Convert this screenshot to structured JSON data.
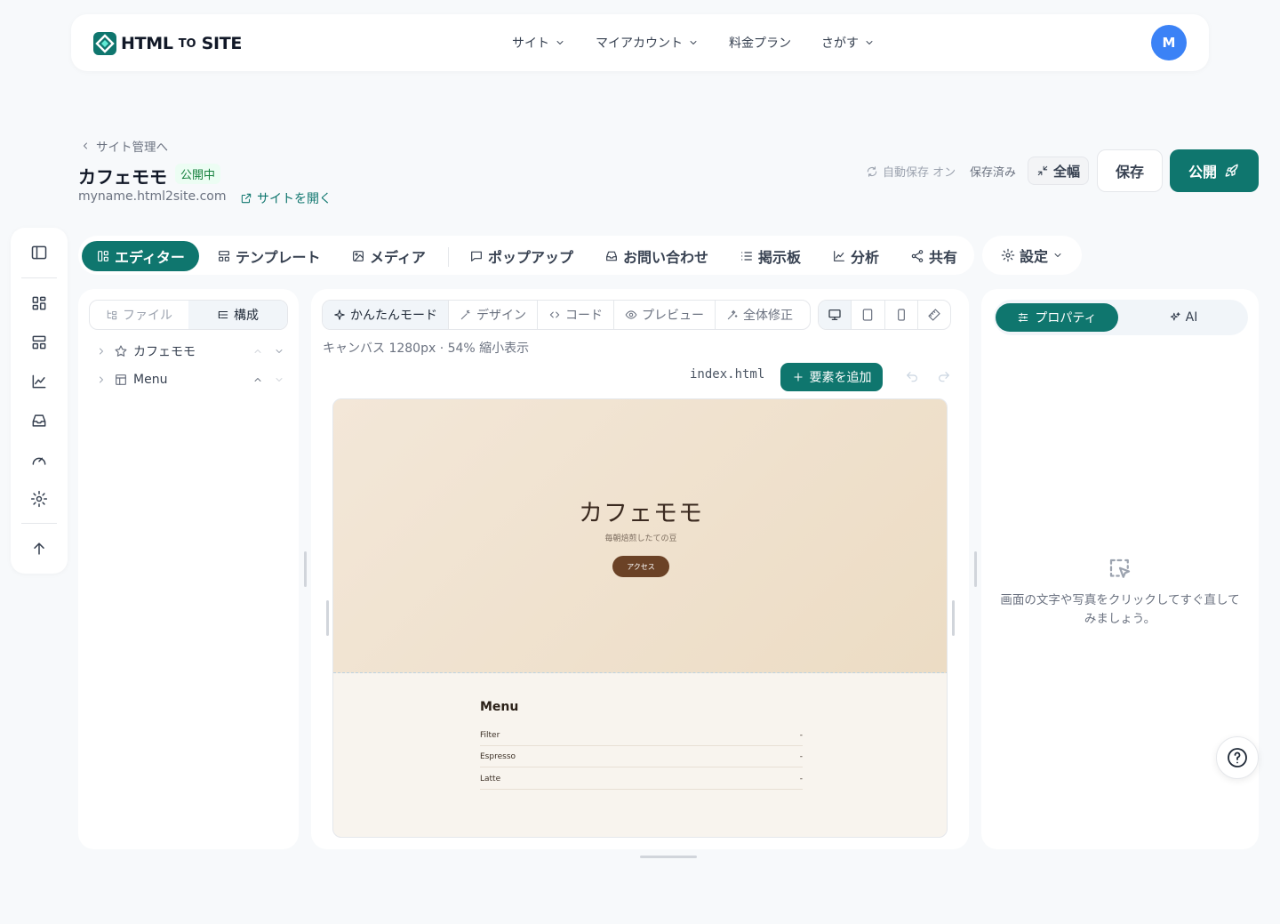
{
  "brand": {
    "part1": "HTML",
    "part2": "TO",
    "part3": "SITE"
  },
  "topnav": {
    "items": [
      "サイト",
      "マイアカウント",
      "料金プラン",
      "さがす"
    ],
    "avatar": "M"
  },
  "header": {
    "back_label": "サイト管理へ",
    "site_title": "カフェモモ",
    "status": "公開中",
    "site_url": "myname.html2site.com",
    "open_site": "サイトを開く",
    "autosave": "自動保存 オン",
    "saved": "保存済み",
    "fullwidth": "全幅",
    "save": "保存",
    "publish": "公開"
  },
  "tabs": [
    "エディター",
    "テンプレート",
    "メディア",
    "ポップアップ",
    "お問い合わせ",
    "掲示板",
    "分析",
    "共有"
  ],
  "settings_label": "設定",
  "left_panel": {
    "segment": [
      "ファイル",
      "構成"
    ],
    "tree": [
      "カフェモモ",
      "Menu"
    ]
  },
  "center": {
    "modes": [
      "かんたんモード",
      "デザイン",
      "コード",
      "プレビュー",
      "全体修正"
    ],
    "canvas_info": "キャンバス 1280px · 54% 縮小表示",
    "filename": "index.html",
    "add_element": "要素を追加"
  },
  "preview": {
    "hero_title": "カフェモモ",
    "hero_subtitle": "毎朝焙煎したての豆",
    "hero_button": "アクセス",
    "menu_title": "Menu",
    "menu_items": [
      {
        "name": "Filter",
        "price": "-"
      },
      {
        "name": "Espresso",
        "price": "-"
      },
      {
        "name": "Latte",
        "price": "-"
      }
    ]
  },
  "right_panel": {
    "tabs": [
      "プロパティ",
      "AI"
    ],
    "empty_text": "画面の文字や写真をクリックしてすぐ直してみましょう。"
  },
  "colors": {
    "primary": "#0f766e",
    "avatar": "#3b82f6",
    "hero_button": "#6b4226"
  }
}
